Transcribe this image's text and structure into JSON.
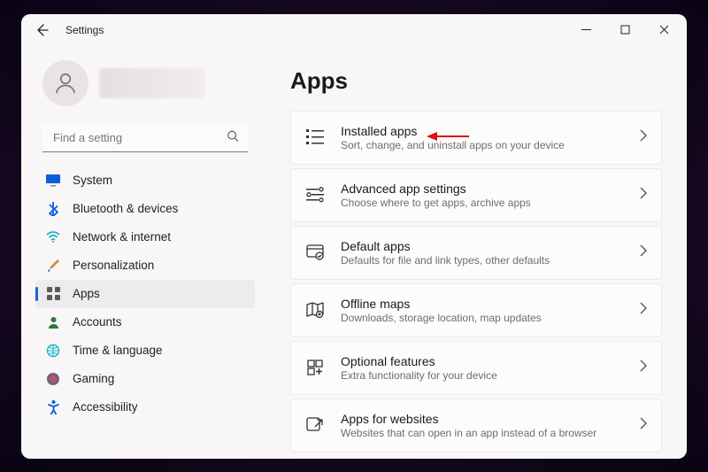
{
  "window": {
    "title": "Settings"
  },
  "page": {
    "title": "Apps"
  },
  "search": {
    "placeholder": "Find a setting"
  },
  "sidebar": {
    "items": [
      {
        "label": "System"
      },
      {
        "label": "Bluetooth & devices"
      },
      {
        "label": "Network & internet"
      },
      {
        "label": "Personalization"
      },
      {
        "label": "Apps"
      },
      {
        "label": "Accounts"
      },
      {
        "label": "Time & language"
      },
      {
        "label": "Gaming"
      },
      {
        "label": "Accessibility"
      }
    ]
  },
  "cards": [
    {
      "title": "Installed apps",
      "sub": "Sort, change, and uninstall apps on your device"
    },
    {
      "title": "Advanced app settings",
      "sub": "Choose where to get apps, archive apps"
    },
    {
      "title": "Default apps",
      "sub": "Defaults for file and link types, other defaults"
    },
    {
      "title": "Offline maps",
      "sub": "Downloads, storage location, map updates"
    },
    {
      "title": "Optional features",
      "sub": "Extra functionality for your device"
    },
    {
      "title": "Apps for websites",
      "sub": "Websites that can open in an app instead of a browser"
    }
  ],
  "annotation": {
    "target_card_index": 0
  }
}
